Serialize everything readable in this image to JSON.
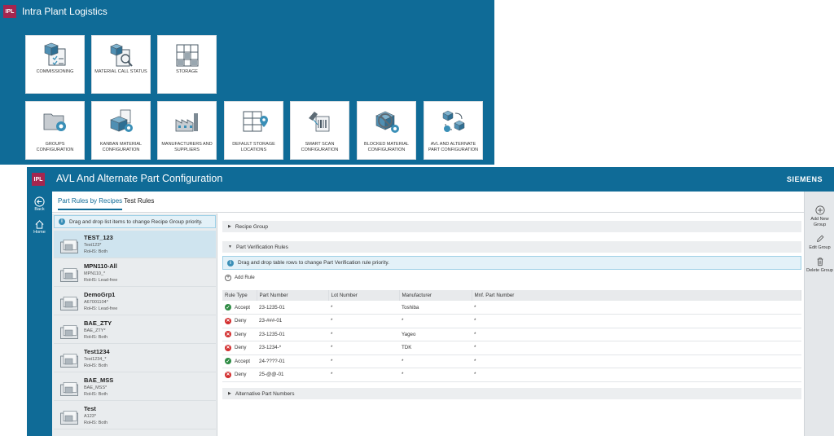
{
  "launcher": {
    "logo": "IPL",
    "title": "Intra Plant Logistics",
    "tiles": [
      {
        "label": "COMMISSIONING",
        "icon": "commissioning-icon"
      },
      {
        "label": "MATERIAL CALL STATUS",
        "icon": "material-call-status-icon"
      },
      {
        "label": "STORAGE",
        "icon": "storage-icon"
      },
      {
        "label": "GROUPS CONFIGURATION",
        "icon": "groups-configuration-icon"
      },
      {
        "label": "KANBAN MATERIAL CONFIGURATION",
        "icon": "kanban-icon"
      },
      {
        "label": "MANUFACTURERS AND SUPPLIERS",
        "icon": "factory-icon"
      },
      {
        "label": "DEFAULT STORAGE LOCATIONS",
        "icon": "storage-location-icon"
      },
      {
        "label": "SMART SCAN CONFIGURATION",
        "icon": "smart-scan-icon"
      },
      {
        "label": "BLOCKED MATERIAL CONFIGURATION",
        "icon": "blocked-material-icon"
      },
      {
        "label": "AVL AND ALTERNATE PART CONFIGURATION",
        "icon": "avl-icon"
      }
    ]
  },
  "window": {
    "logo": "IPL",
    "title": "AVL And Alternate Part Configuration",
    "brand": "SIEMENS"
  },
  "nav": {
    "back": "Back",
    "home": "Home"
  },
  "tabs": [
    "Part Rules by Recipes",
    "Test Rules"
  ],
  "group_list": {
    "info": "Drag and drop list items to change Recipe Group priority.",
    "groups": [
      {
        "name": "TEST_123",
        "pattern": "Test123*",
        "rohs": "RoHS: Both"
      },
      {
        "name": "MPN110-All",
        "pattern": "MPN110_*",
        "rohs": "RoHS: Lead-free"
      },
      {
        "name": "DemoGrp1",
        "pattern": "A67001104*",
        "rohs": "RoHS: Lead-free"
      },
      {
        "name": "BAE_ZTY",
        "pattern": "BAE_ZTY*",
        "rohs": "RoHS: Both"
      },
      {
        "name": "Test1234",
        "pattern": "Test1234_*",
        "rohs": "RoHS: Both"
      },
      {
        "name": "BAE_MSS",
        "pattern": "BAE_MSS*",
        "rohs": "RoHS: Both"
      },
      {
        "name": "Test",
        "pattern": "A123*",
        "rohs": "RoHS: Both"
      }
    ]
  },
  "sections": {
    "recipe_group": "Recipe Group",
    "part_verification": "Part Verification Rules",
    "alternative": "Alternative Part Numbers"
  },
  "rules": {
    "info": "Drag and drop table rows to change Part Verification rule priority.",
    "add_label": "Add Rule",
    "columns": [
      "Rule Type",
      "Part Number",
      "Lot Number",
      "Manufacturer",
      "Mnf. Part Number"
    ],
    "rows": [
      {
        "type": "Accept",
        "part": "23-1235-01",
        "lot": "*",
        "mfr": "Toshiba",
        "mpn": "*"
      },
      {
        "type": "Deny",
        "part": "23-###-01",
        "lot": "*",
        "mfr": "*",
        "mpn": "*"
      },
      {
        "type": "Deny",
        "part": "23-1235-01",
        "lot": "*",
        "mfr": "Yageo",
        "mpn": "*"
      },
      {
        "type": "Deny",
        "part": "23-1234-*",
        "lot": "*",
        "mfr": "TDK",
        "mpn": "*"
      },
      {
        "type": "Accept",
        "part": "24-????-01",
        "lot": "*",
        "mfr": "*",
        "mpn": "*"
      },
      {
        "type": "Deny",
        "part": "25-@@-01",
        "lot": "*",
        "mfr": "*",
        "mpn": "*"
      }
    ]
  },
  "actions": {
    "add": "Add New Group",
    "edit": "Edit Group",
    "delete": "Delete Group"
  },
  "colors": {
    "primary": "#0f6b97",
    "accent_logo": "#a5264f",
    "accept": "#2e8b44",
    "deny": "#d32f2f"
  }
}
